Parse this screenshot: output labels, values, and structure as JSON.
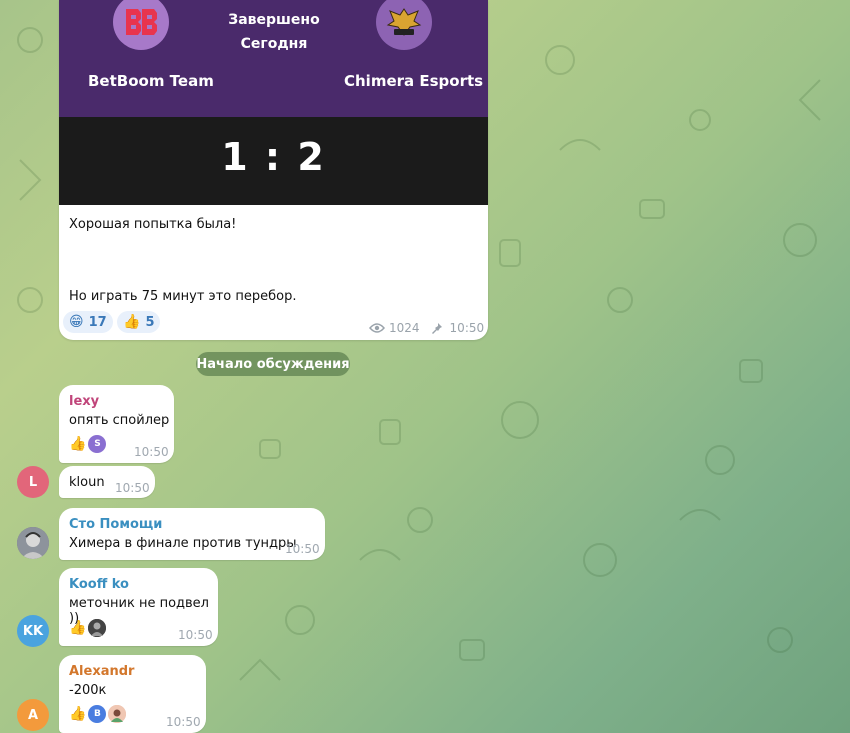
{
  "post": {
    "team_left": "BetBoom Team",
    "team_right": "Chimera Esports",
    "status_line1": "Завершено",
    "status_line2": "Сегодня",
    "score": "1 : 2",
    "text_line1": "Хорошая попытка была!",
    "text_line2": "Но играть 75 минут это перебор.",
    "reactions": [
      {
        "emoji": "😁",
        "count": "17"
      },
      {
        "emoji": "👍",
        "count": "5"
      }
    ],
    "views": "1024",
    "time": "10:50"
  },
  "divider": "Начало обсуждения",
  "messages": [
    {
      "author": "lexy",
      "author_color": "#c0457a",
      "text": "опять спойлер",
      "time": "10:50",
      "reaction": "👍",
      "reactor_initial": "S"
    },
    {
      "author": "",
      "text": "kloun",
      "time": "10:50",
      "avatar_initial": "L",
      "avatar_color": "#e2667a"
    },
    {
      "author": "Сто Помощи",
      "author_color": "#3a8fc0",
      "text": "Химера в финале против тундры",
      "time": "10:50"
    },
    {
      "author": "Kooff ko",
      "author_color": "#3a8fc0",
      "text": "меточник не подвел ))",
      "time": "10:50",
      "reaction": "👍",
      "avatar_initial": "KK",
      "avatar_color": "#4aa3df"
    },
    {
      "author": "Alexandr",
      "author_color": "#d3772c",
      "text": "-200к",
      "time": "10:50",
      "reaction": "👍",
      "reactor_initial": "B",
      "avatar_initial": "A",
      "avatar_color": "#f39a3c"
    }
  ],
  "colors": {
    "banner": "#4a2a6b",
    "scorebar": "#1b1b1b",
    "reaction_bg": "#e8f0fb"
  }
}
